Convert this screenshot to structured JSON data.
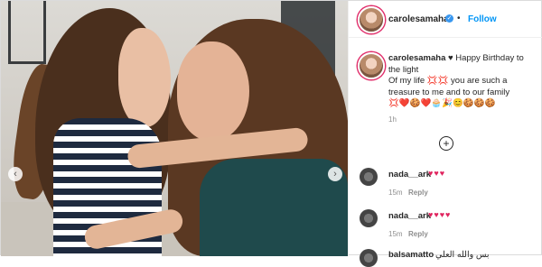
{
  "post": {
    "username": "carolesamaha",
    "verified_icon": "verified-badge-icon",
    "separator": "•",
    "follow_label": "Follow",
    "more_icon": "•••",
    "caption_user": "carolesamaha",
    "caption_lines": [
      "♥ Happy Birthday to",
      "the light",
      "Of my life 💢💢 you are such a",
      "treasure to me and to our family",
      "💢❤️🍪❤️🧁🎉😊🍪🍪🍪"
    ],
    "caption_time": "1h",
    "add_icon": "+"
  },
  "comments": [
    {
      "user": "nada__ark",
      "text": "♥♥♥",
      "time": "15m",
      "reply": "Reply"
    },
    {
      "user": "nada__ark",
      "text": "♥♥♥♥",
      "time": "15m",
      "reply": "Reply"
    },
    {
      "user": "balsamatto",
      "text": "بس والله العلي",
      "time": "",
      "reply": ""
    }
  ],
  "photo": {
    "prev_icon": "‹",
    "next_icon": "›"
  },
  "colors": {
    "link": "#0095f6",
    "heart": "#e0245e",
    "muted": "#8e8e8e"
  }
}
